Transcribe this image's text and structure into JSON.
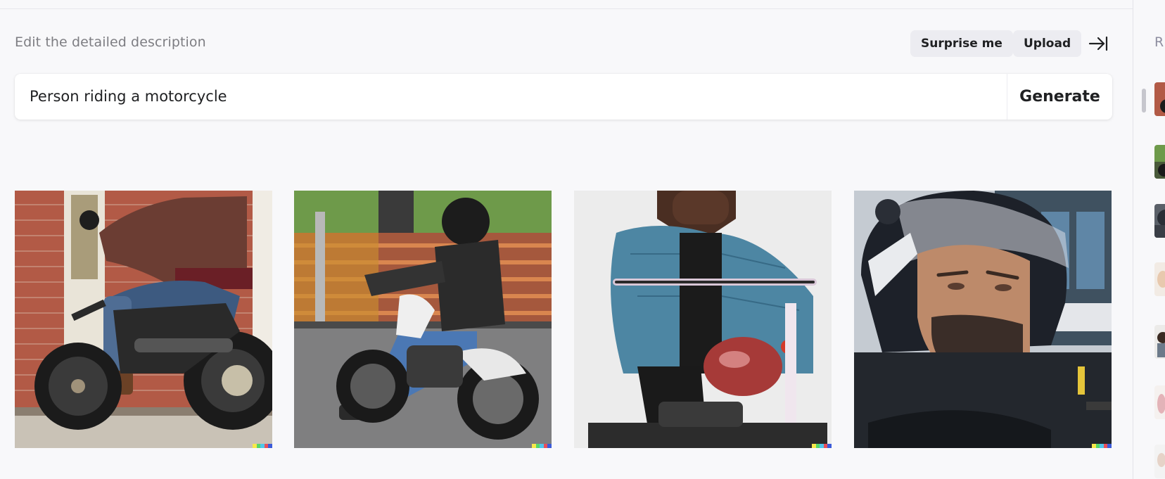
{
  "editor": {
    "section_label": "Edit the detailed description",
    "surprise_label": "Surprise me",
    "upload_label": "Upload",
    "collapse_icon": "arrow-right-to-bar-icon",
    "prompt_value": "Person riding a motorcycle",
    "generate_label": "Generate"
  },
  "results": [
    {
      "subject": "rider on black motorcycle by brick wall"
    },
    {
      "subject": "rider on white motorcycle on street"
    },
    {
      "subject": "woman in denim jacket on red motorcycle"
    },
    {
      "subject": "bearded man in helmet close-up"
    }
  ],
  "history": {
    "title": "R"
  },
  "colors": {
    "background": "#f8f8fa",
    "chip_bg": "#ececf1",
    "text": "#202123",
    "muted": "#7d7d82"
  }
}
